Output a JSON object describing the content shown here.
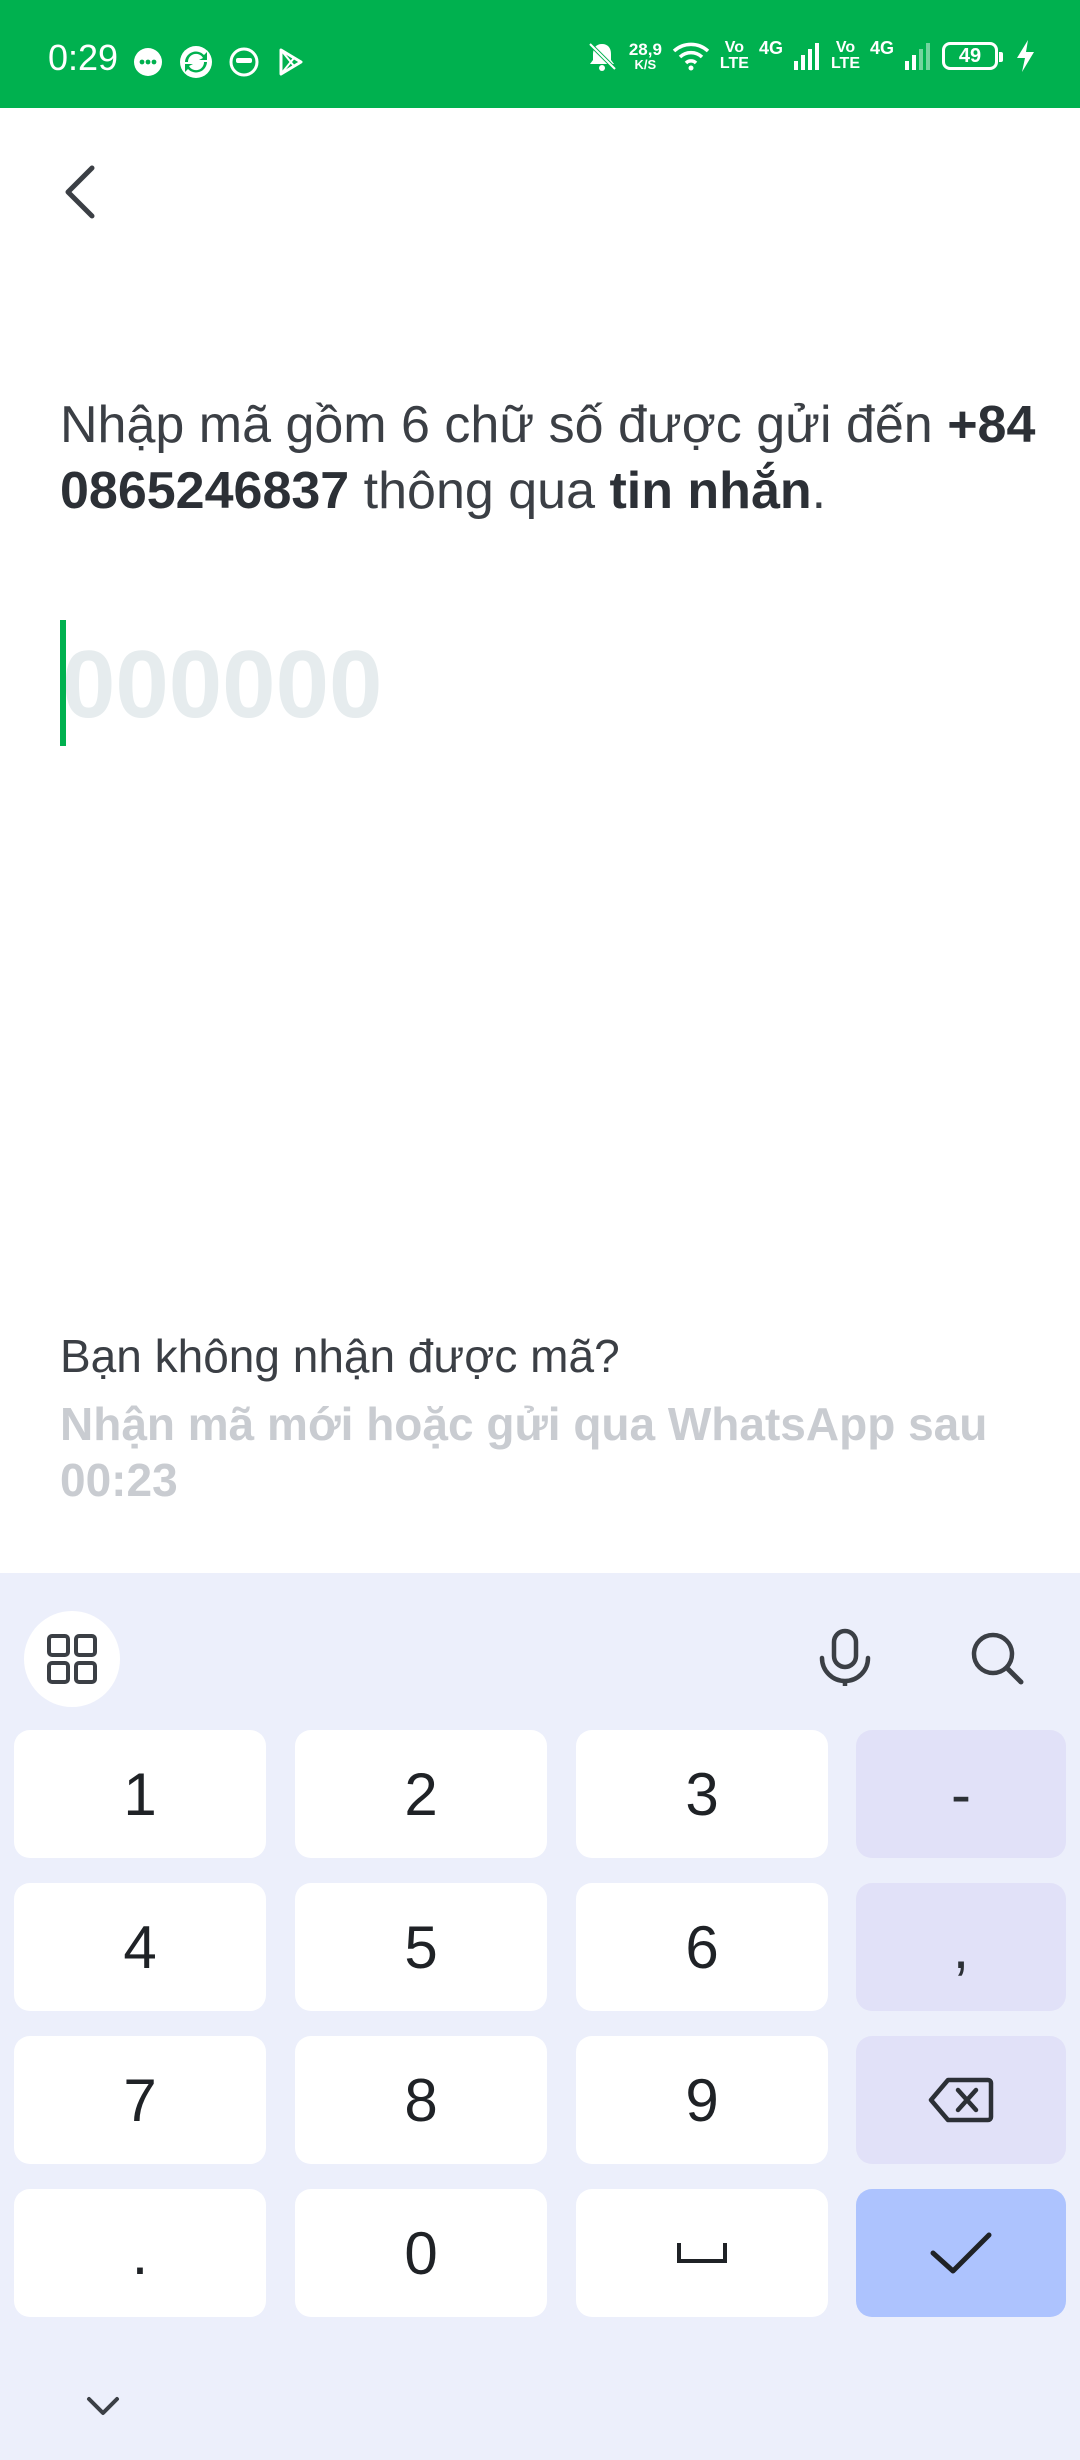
{
  "status_bar": {
    "time": "0:29",
    "net_speed_value": "28,9",
    "net_speed_unit": "K/S",
    "volte_top": "Vo",
    "volte_bottom": "LTE",
    "network_type": "4G",
    "battery_level": "49",
    "color": "#00b14f"
  },
  "header": {
    "back_icon": "chevron-left-icon"
  },
  "instruction": {
    "prefix": "Nhập mã gồm 6 chữ số được gửi đến ",
    "phone_line1": "+84",
    "phone_line2": "0865246837",
    "middle": " thông qua ",
    "channel": "tin nhắn",
    "suffix": "."
  },
  "code_input": {
    "placeholder": "000000",
    "value": "",
    "caret_color": "#00b14f"
  },
  "resend": {
    "question": "Bạn không nhận được mã?",
    "info": "Nhận mã mới hoặc gửi qua WhatsApp sau",
    "countdown": "00:23"
  },
  "keyboard": {
    "toolbar": {
      "grid_icon": "apps-grid-icon",
      "mic_icon": "microphone-icon",
      "search_icon": "search-icon"
    },
    "keys": {
      "k1": "1",
      "k2": "2",
      "k3": "3",
      "dash": "-",
      "k4": "4",
      "k5": "5",
      "k6": "6",
      "comma": ",",
      "k7": "7",
      "k8": "8",
      "k9": "9",
      "dot": ".",
      "k0": "0"
    },
    "backspace_icon": "backspace-icon",
    "space_icon": "space-icon",
    "done_icon": "checkmark-icon",
    "hide_icon": "chevron-down-icon",
    "background": "#eceffb",
    "done_color": "#adc3fe"
  }
}
